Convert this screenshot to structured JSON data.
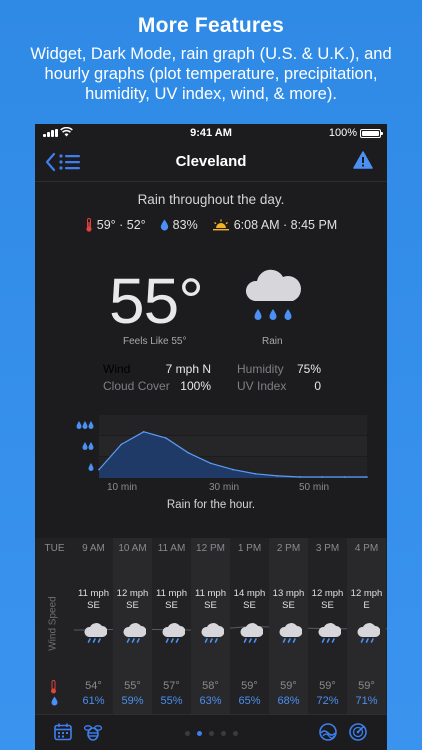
{
  "promo": {
    "title": "More Features",
    "subtitle_line1": "Widget, Dark Mode, rain graph (U.S. & U.K.), and",
    "subtitle_line2": "hourly graphs (plot temperature, precipitation,",
    "subtitle_line3": "humidity, UV index, wind, & more)."
  },
  "status_bar": {
    "time": "9:41 AM",
    "battery": "100%"
  },
  "nav": {
    "title": "Cleveland"
  },
  "summary": {
    "text": "Rain throughout the day.",
    "temps": "59° · 52°",
    "precip": "83%",
    "sun": "6:08 AM · 8:45 PM"
  },
  "current": {
    "temp": "55°",
    "feels_like": "Feels Like 55°",
    "condition": "Rain",
    "wind_label": "Wind",
    "wind_value": "7 mph N",
    "cloud_label": "Cloud Cover",
    "cloud_value": "100%",
    "humidity_label": "Humidity",
    "humidity_value": "75%",
    "uv_label": "UV Index",
    "uv_value": "0"
  },
  "rain_graph": {
    "ticks": [
      "10 min",
      "30 min",
      "50 min"
    ],
    "caption": "Rain for the hour."
  },
  "chart_data": {
    "type": "area",
    "x": [
      0,
      5,
      10,
      15,
      20,
      25,
      30,
      35,
      40,
      45,
      50,
      55,
      60
    ],
    "values": [
      0.4,
      1.6,
      2.2,
      1.9,
      1.2,
      0.7,
      0.4,
      0.2,
      0.1,
      0.05,
      0.05,
      0.05,
      0.05
    ],
    "xlabel": "",
    "ylabel": "",
    "xticks": [
      "10 min",
      "30 min",
      "50 min"
    ],
    "ylim": [
      0,
      3
    ],
    "grid": true
  },
  "hourly": {
    "day": "TUE",
    "side_label": "Wind Speed",
    "hours": [
      {
        "time": "9 AM",
        "speed": "11 mph",
        "dir": "SE",
        "temp": "54°",
        "hum": "61%"
      },
      {
        "time": "10 AM",
        "speed": "12 mph",
        "dir": "SE",
        "temp": "55°",
        "hum": "59%"
      },
      {
        "time": "11 AM",
        "speed": "11 mph",
        "dir": "SE",
        "temp": "57°",
        "hum": "55%"
      },
      {
        "time": "12 PM",
        "speed": "11 mph",
        "dir": "SE",
        "temp": "58°",
        "hum": "63%"
      },
      {
        "time": "1 PM",
        "speed": "14 mph",
        "dir": "SE",
        "temp": "59°",
        "hum": "65%"
      },
      {
        "time": "2 PM",
        "speed": "13 mph",
        "dir": "SE",
        "temp": "59°",
        "hum": "68%"
      },
      {
        "time": "3 PM",
        "speed": "12 mph",
        "dir": "SE",
        "temp": "59°",
        "hum": "72%"
      },
      {
        "time": "4 PM",
        "speed": "12 mph",
        "dir": "E",
        "temp": "59°",
        "hum": "71%"
      }
    ]
  },
  "pager": {
    "count": 5,
    "active": 1
  },
  "colors": {
    "accent": "#3d7ff0",
    "alert": "#4a90f5",
    "rain_fill": "#1f3a66",
    "thermometer": "#e0423c",
    "sun": "#f2b224"
  }
}
